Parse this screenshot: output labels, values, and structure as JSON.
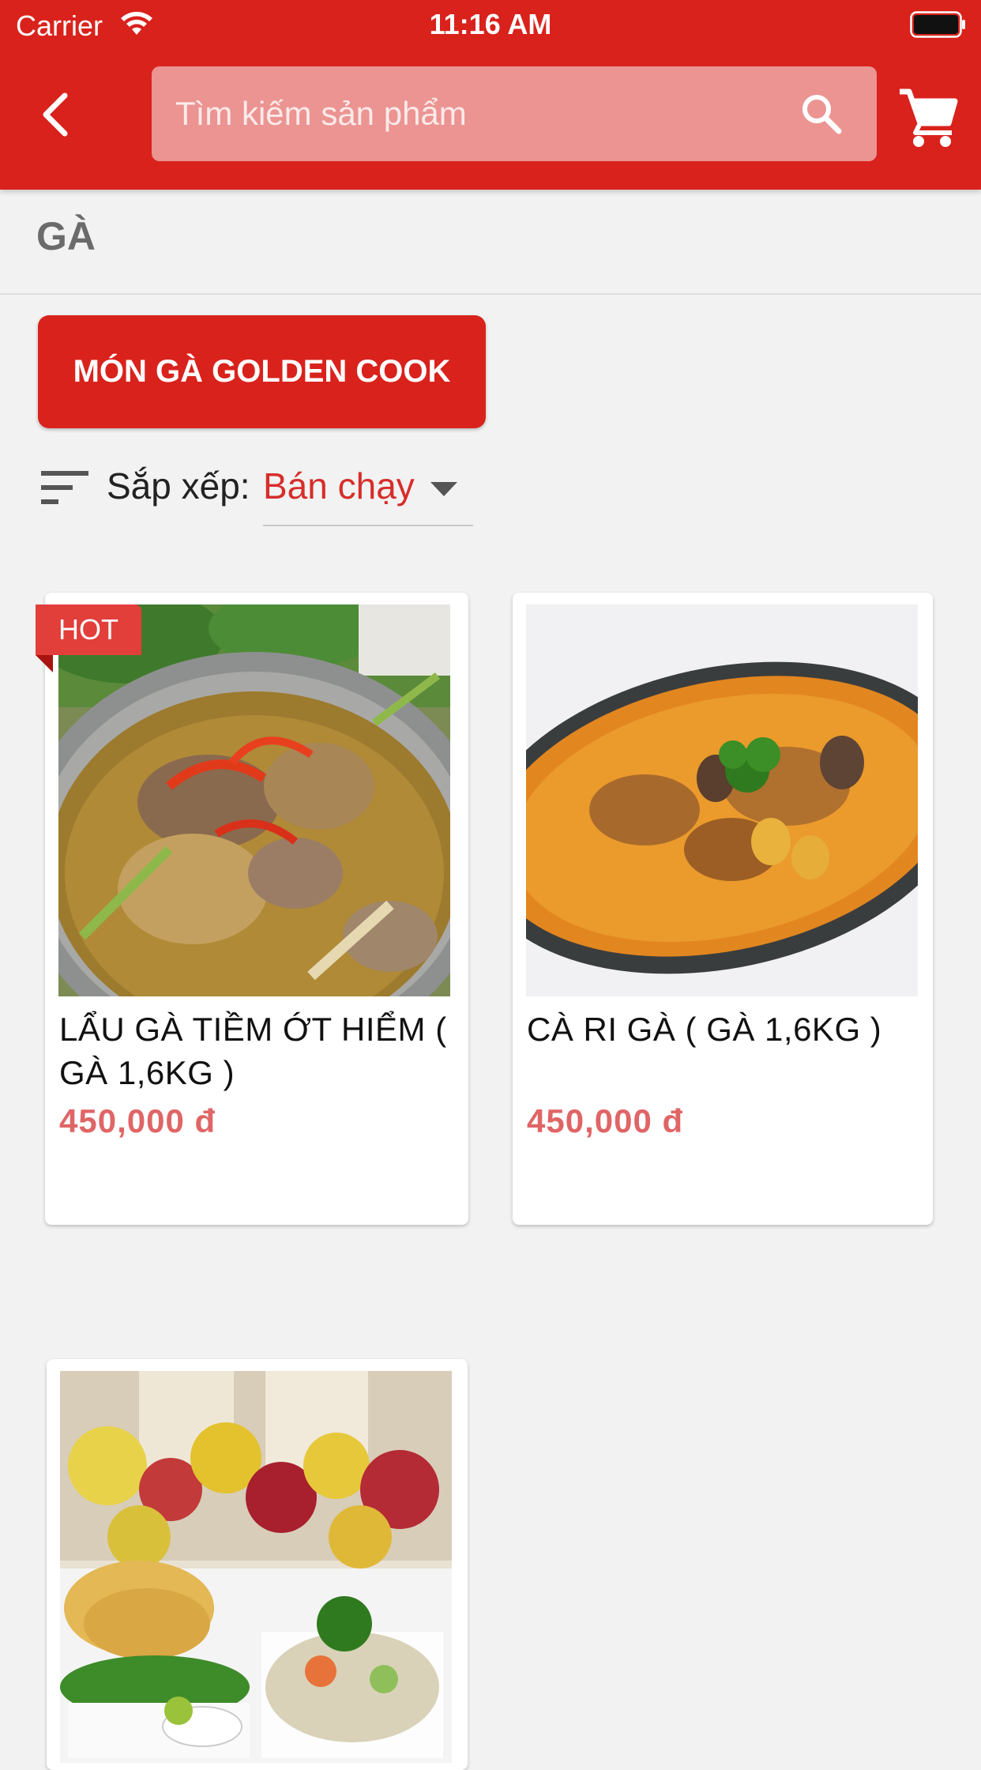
{
  "status_bar": {
    "carrier": "Carrier",
    "time": "11:16 AM"
  },
  "header": {
    "search_placeholder": "Tìm kiếm sản phẩm",
    "accent_color": "#d9221c"
  },
  "category": {
    "title": "GÀ"
  },
  "chip": {
    "label": "MÓN GÀ GOLDEN COOK"
  },
  "sort": {
    "label": "Sắp xếp:",
    "value": "Bán chạy"
  },
  "products": [
    {
      "title": "LẨU GÀ TIỀM ỚT HIỂM ( GÀ 1,6KG )",
      "price": "450,000 đ",
      "badge": "HOT",
      "image": "chicken-hotpot"
    },
    {
      "title": "CÀ RI GÀ ( GÀ 1,6KG )",
      "price": "450,000 đ",
      "image": "chicken-curry"
    },
    {
      "image": "boiled-chicken-platter"
    }
  ],
  "icons": [
    "back-icon",
    "search-icon",
    "cart-icon",
    "sort-icon",
    "chevron-down-icon",
    "wifi-icon",
    "battery-icon"
  ]
}
